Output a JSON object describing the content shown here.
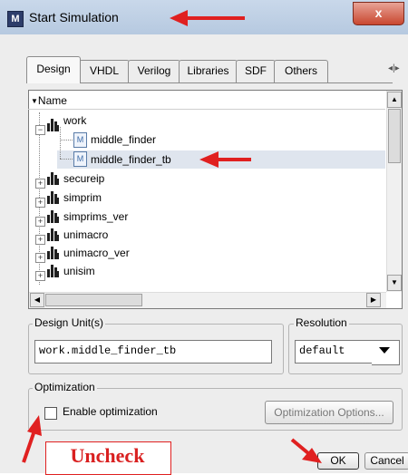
{
  "window": {
    "title": "Start Simulation",
    "app_icon": "M",
    "close_label": "x"
  },
  "tabs": [
    {
      "label": "Design"
    },
    {
      "label": "VHDL"
    },
    {
      "label": "Verilog"
    },
    {
      "label": "Libraries"
    },
    {
      "label": "SDF"
    },
    {
      "label": "Others"
    }
  ],
  "tab_scroll_glyph": "◂|▸",
  "tree": {
    "column_header": "Name",
    "header_glyph": "▼",
    "items": [
      {
        "label": "work",
        "type": "library",
        "expanded": true
      },
      {
        "label": "middle_finder",
        "type": "module"
      },
      {
        "label": "middle_finder_tb",
        "type": "module",
        "selected": true
      },
      {
        "label": "secureip",
        "type": "library"
      },
      {
        "label": "simprim",
        "type": "library"
      },
      {
        "label": "simprims_ver",
        "type": "library"
      },
      {
        "label": "unimacro",
        "type": "library"
      },
      {
        "label": "unimacro_ver",
        "type": "library"
      },
      {
        "label": "unisim",
        "type": "library"
      }
    ]
  },
  "design_unit": {
    "label": "Design Unit(s)",
    "value": "work.middle_finder_tb"
  },
  "resolution": {
    "label": "Resolution",
    "value": "default"
  },
  "optimization": {
    "label": "Optimization",
    "checkbox_label": "Enable optimization",
    "checked": false,
    "options_button": "Optimization Options..."
  },
  "buttons": {
    "ok": "OK",
    "cancel": "Cancel"
  },
  "annotations": {
    "uncheck_text": "Uncheck",
    "color": "#e02020"
  },
  "colors": {
    "titlebar": "#c9d8ea",
    "selection": "#dfe5ee",
    "close": "#c9472f"
  }
}
